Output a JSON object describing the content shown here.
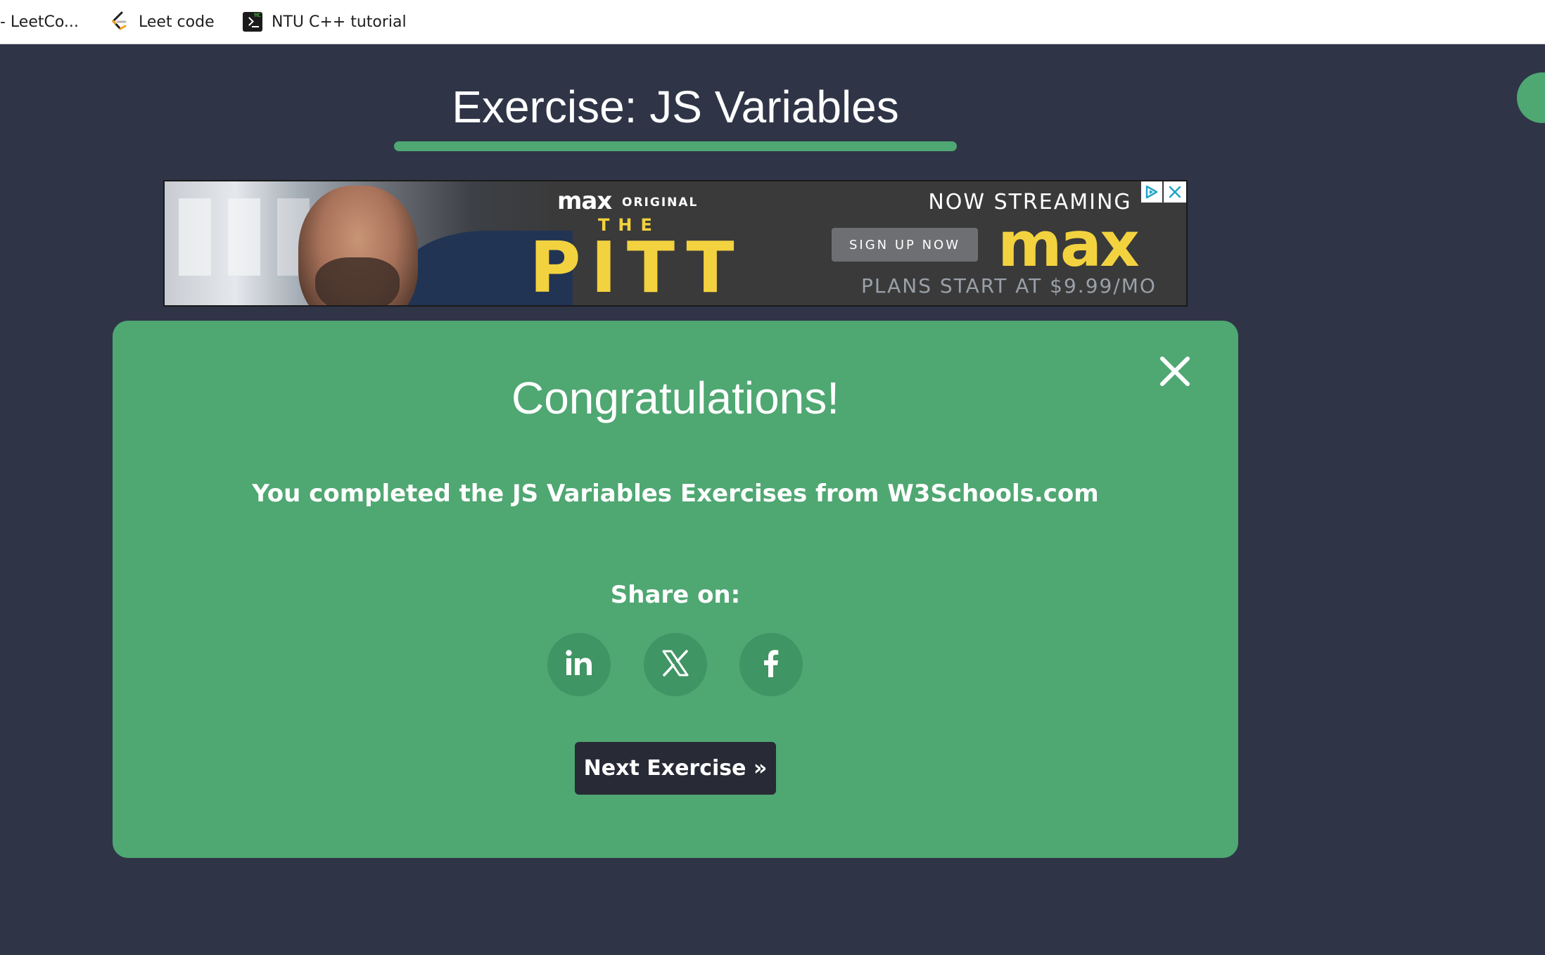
{
  "bookmarks": [
    {
      "label": "- LeetCo..."
    },
    {
      "label": "Leet code",
      "icon": "leetcode-icon"
    },
    {
      "label": "NTU C++ tutorial",
      "icon": "terminal-icon"
    }
  ],
  "exercise": {
    "title": "Exercise: JS Variables",
    "progress": 1.0
  },
  "ad": {
    "brand_small": "max",
    "original": "ORIGINAL",
    "the": "THE",
    "show": "PITT",
    "now_streaming": "NOW STREAMING",
    "signup": "SIGN UP NOW",
    "brand_big": "max",
    "plans": "PLANS START AT $9.99/MO"
  },
  "modal": {
    "heading": "Congratulations!",
    "message": "You completed the JS Variables Exercises from W3Schools.com",
    "share_label": "Share on:",
    "share_buttons": [
      "linkedin",
      "x",
      "facebook"
    ],
    "next_button": "Next Exercise »"
  },
  "colors": {
    "background": "#2f3547",
    "accent_green": "#4fa772",
    "share_button_bg": "#3f9563",
    "next_button_bg": "#282a35",
    "ad_yellow": "#f3d23f"
  }
}
